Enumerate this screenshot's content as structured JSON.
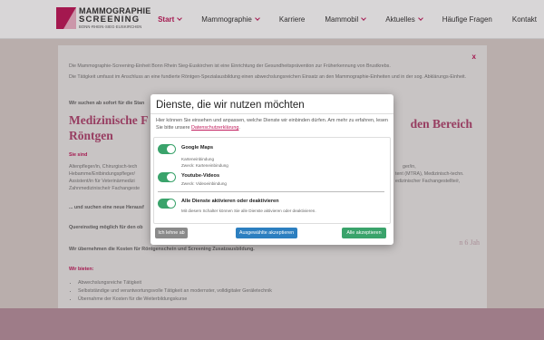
{
  "logo": {
    "line1": "MAMMOGRAPHIE",
    "line2": "SCREENING",
    "line3": "BONN·RHEIN·SIEG·EUSKIRCHEN"
  },
  "nav": {
    "items": [
      {
        "label": "Start",
        "dropdown": true,
        "active": true
      },
      {
        "label": "Mammographie",
        "dropdown": true
      },
      {
        "label": "Karriere",
        "dropdown": false
      },
      {
        "label": "Mammobil",
        "dropdown": true
      },
      {
        "label": "Aktuelles",
        "dropdown": true
      },
      {
        "label": "Häufige Fragen",
        "dropdown": false
      },
      {
        "label": "Kontakt",
        "dropdown": false
      }
    ]
  },
  "background": {
    "close": "x",
    "intro1": "Die Mammographie-Screening-Einheit Bonn Rhein Sieg-Euskirchen ist eine Einrichtung der Gesundheitsprävention zur Früherkennung von Brustkrebs.",
    "intro2": "Die Tätigkeit umfasst im Anschluss an eine fundierte Röntgen-Spezialausbildung einen abwechslungsreichen Einsatz an den Mammographie-Einheiten und in der sog. Abklärungs-Einheit.",
    "wanted": "Wir suchen ab sofort für die Stan",
    "heading_left": "Medizinische F",
    "heading_right": "den Bereich",
    "heading_line2": "Röntgen",
    "you_are": "Sie sind",
    "profile1": "Altenpfleger/in, Chirurgisch-tech",
    "profile1_right": "ger/in,",
    "profile2": "Hebamme/Entbindungspfleger/",
    "profile2_right": "tent (MTRA), Medizinisch-techn.",
    "profile3": "Assistent/in für Veterinärmedizi",
    "profile3_right": "edizinischer Fachangestellte/r,",
    "profile4": "Zahnmedizinische/r Fachangeste",
    "search_more": "... und suchen eine neue Herausf",
    "lateral": "Quereinstieg möglich für den ob",
    "date_fragment": "n 6 Jah",
    "costs": "Wir übernehmen die Kosten für Röntgenschein und Screening Zusatzausbildung.",
    "we_offer": "Wir bieten:",
    "offers": [
      "Abwechslungsreiche Tätigkeit",
      "Selbstständige und verantwortungsvolle Tätigkeit an modernster, volldigitaler Geräletechnik",
      "Übernahme der Kosten für die Weiterbildungskurse"
    ]
  },
  "modal": {
    "title": "Dienste, die wir nutzen möchten",
    "desc_prefix": "Hier können Sie einsehen und anpassen, welche Dienste wir einbinden dürfen. Am mehr zu erfahren, lesen Sie bitte unsere ",
    "desc_link": "Datenschutzerklärung",
    "desc_suffix": ".",
    "services": [
      {
        "name": "Google Maps",
        "desc": "Karteneinbindung",
        "purpose": "Zweck: Karteneinbindung",
        "enabled": true
      },
      {
        "name": "Youtube-Videos",
        "desc": "",
        "purpose": "Zweck: Videoeinbindung",
        "enabled": true
      }
    ],
    "all_toggle": {
      "name": "Alle Dienste aktivieren oder deaktivieren",
      "desc": "Mit diesem Schalter können Sie alle Dienste aktivieren oder deaktivieren.",
      "enabled": true
    },
    "buttons": {
      "decline": "Ich lehne ab",
      "accept_selected": "Ausgewählte akzeptieren",
      "accept_all": "Alle akzeptieren"
    }
  },
  "colors": {
    "brand": "#c0185a",
    "toggle_on": "#3aa36b",
    "accept_selected": "#2c7fc0",
    "decline": "#8a8a8a"
  }
}
